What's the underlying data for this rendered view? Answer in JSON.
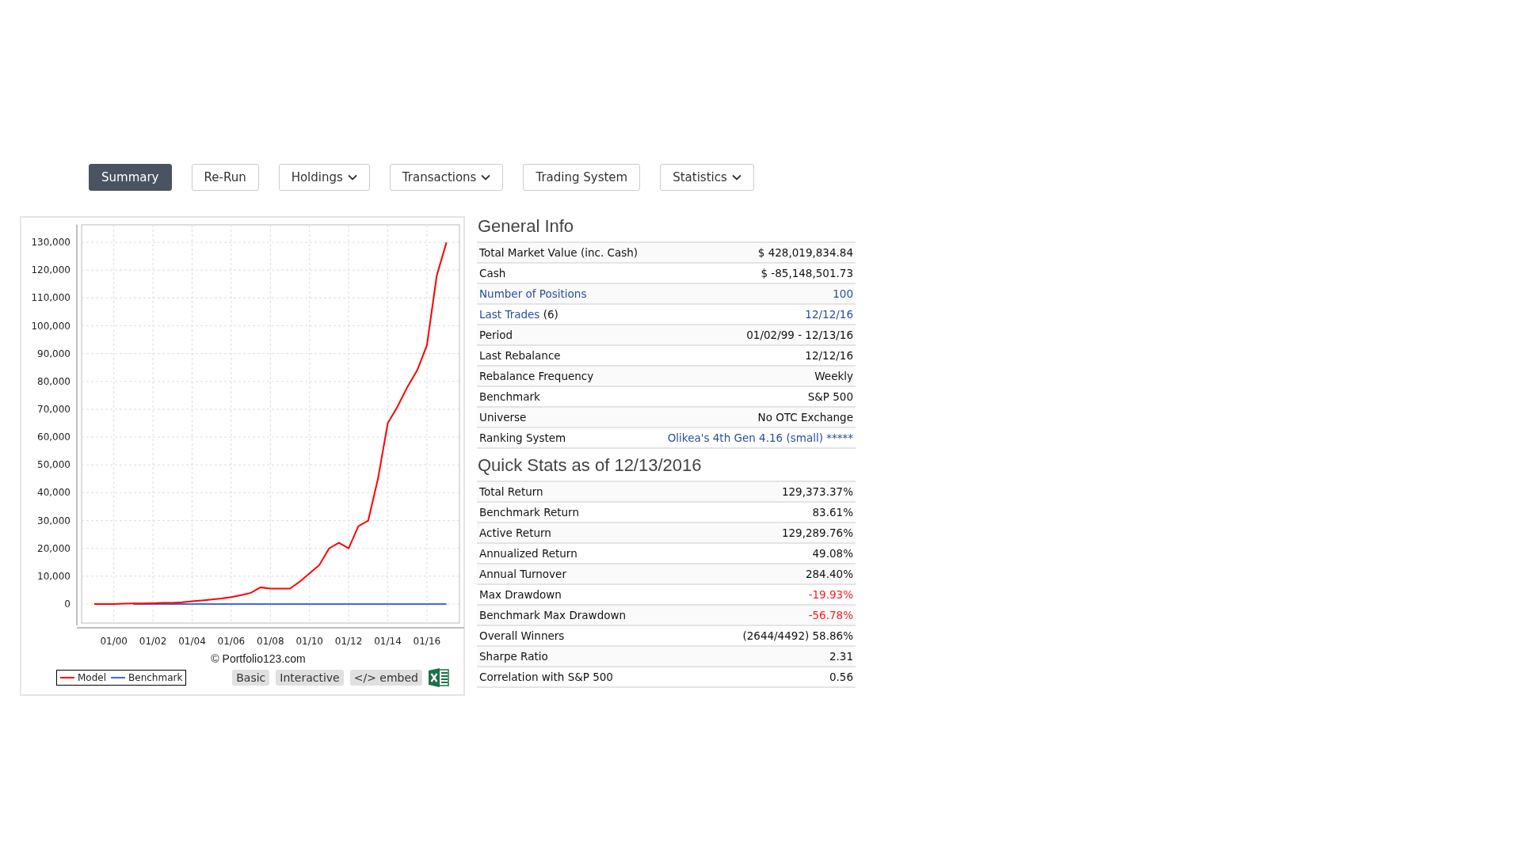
{
  "tabs": [
    {
      "label": "Summary",
      "selected": true,
      "dropdown": false
    },
    {
      "label": "Re-Run",
      "selected": false,
      "dropdown": false
    },
    {
      "label": "Holdings",
      "selected": false,
      "dropdown": true
    },
    {
      "label": "Transactions",
      "selected": false,
      "dropdown": true
    },
    {
      "label": "Trading System",
      "selected": false,
      "dropdown": false
    },
    {
      "label": "Statistics",
      "selected": false,
      "dropdown": true
    }
  ],
  "chart_panel": {
    "chart_data": {
      "type": "line",
      "categories": [
        null,
        null,
        "01/00",
        null,
        null,
        null,
        "01/02",
        null,
        null,
        null,
        "01/04",
        null,
        null,
        null,
        "01/06",
        null,
        null,
        null,
        "01/08",
        null,
        null,
        null,
        "01/10",
        null,
        null,
        null,
        "01/12",
        null,
        null,
        null,
        "01/14",
        null,
        null,
        null,
        "01/16",
        null,
        null
      ],
      "series": [
        {
          "name": "Model",
          "color": "#ff0000",
          "values": [
            0,
            0,
            0,
            100,
            200,
            200,
            300,
            400,
            400,
            600,
            1000,
            1300,
            1600,
            2000,
            2500,
            3200,
            4000,
            6000,
            5500,
            5500,
            5500,
            8000,
            11000,
            14000,
            20000,
            22000,
            20000,
            28000,
            30000,
            45000,
            65000,
            71000,
            78000,
            84000,
            93000,
            118000,
            130000
          ]
        },
        {
          "name": "Benchmark",
          "color": "#4169e1",
          "values": [
            null,
            null,
            null,
            null,
            0,
            0,
            0,
            0,
            0,
            0,
            0,
            0,
            0,
            0,
            0,
            0,
            0,
            0,
            0,
            0,
            0,
            0,
            0,
            0,
            0,
            0,
            0,
            0,
            0,
            0,
            0,
            0,
            0,
            0,
            0,
            0,
            0
          ]
        }
      ],
      "ylim": [
        -7700,
        136300
      ],
      "grid": true,
      "yticks": [
        {
          "value": 0,
          "label": "0"
        },
        {
          "value": 10000,
          "label": "10,000"
        },
        {
          "value": 20000,
          "label": "20,000"
        },
        {
          "value": 30000,
          "label": "30,000"
        },
        {
          "value": 40000,
          "label": "40,000"
        },
        {
          "value": 50000,
          "label": "50,000"
        },
        {
          "value": 60000,
          "label": "60,000"
        },
        {
          "value": 70000,
          "label": "70,000"
        },
        {
          "value": 80000,
          "label": "80,000"
        },
        {
          "value": 90000,
          "label": "90,000"
        },
        {
          "value": 100000,
          "label": "100,000"
        },
        {
          "value": 110000,
          "label": "110,000"
        },
        {
          "value": 120000,
          "label": "120,000"
        },
        {
          "value": 130000,
          "label": "130,000"
        }
      ]
    },
    "copyright": "© Portfolio123.com",
    "buttons": [
      "Basic",
      "Interactive",
      "</> embed"
    ]
  },
  "sections": [
    {
      "title": "General Info",
      "rows": [
        {
          "label": "Total Market Value (inc. Cash)",
          "value": "$ 428,019,834.84",
          "label_link": false,
          "value_link": false,
          "negative": false
        },
        {
          "label": "Cash",
          "value": "$ -85,148,501.73",
          "label_link": false,
          "value_link": false,
          "negative": false
        },
        {
          "label": "Number of Positions",
          "value": "100",
          "label_link": true,
          "value_link": true,
          "negative": false
        },
        {
          "label": "Last Trades",
          "label_note": "(6)",
          "value": "12/12/16",
          "label_link": true,
          "value_link": true,
          "negative": false
        },
        {
          "label": "Period",
          "value": "01/02/99 - 12/13/16",
          "label_link": false,
          "value_link": false,
          "negative": false
        },
        {
          "label": "Last Rebalance",
          "value": "12/12/16",
          "label_link": false,
          "value_link": false,
          "negative": false
        },
        {
          "label": "Rebalance Frequency",
          "value": "Weekly",
          "label_link": false,
          "value_link": false,
          "negative": false
        },
        {
          "label": "Benchmark",
          "value": "S&P 500",
          "label_link": false,
          "value_link": false,
          "negative": false
        },
        {
          "label": "Universe",
          "value": "No OTC Exchange",
          "label_link": false,
          "value_link": false,
          "negative": false
        },
        {
          "label": "Ranking System",
          "value": "Olikea's 4th Gen 4.16 (small)",
          "value_note": "*****",
          "label_link": false,
          "value_link": true,
          "negative": false
        }
      ]
    },
    {
      "title": "Quick Stats as of 12/13/2016",
      "rows": [
        {
          "label": "Total Return",
          "value": "129,373.37%",
          "label_link": false,
          "value_link": false,
          "negative": false
        },
        {
          "label": "Benchmark Return",
          "value": "83.61%",
          "label_link": false,
          "value_link": false,
          "negative": false
        },
        {
          "label": "Active Return",
          "value": "129,289.76%",
          "label_link": false,
          "value_link": false,
          "negative": false
        },
        {
          "label": "Annualized Return",
          "value": "49.08%",
          "label_link": false,
          "value_link": false,
          "negative": false
        },
        {
          "label": "Annual Turnover",
          "value": "284.40%",
          "label_link": false,
          "value_link": false,
          "negative": false
        },
        {
          "label": "Max Drawdown",
          "value": "-19.93%",
          "label_link": false,
          "value_link": false,
          "negative": true
        },
        {
          "label": "Benchmark Max Drawdown",
          "value": "-56.78%",
          "label_link": false,
          "value_link": false,
          "negative": true
        },
        {
          "label": "Overall Winners",
          "value": "(2644/4492) 58.86%",
          "label_link": false,
          "value_link": false,
          "negative": false
        },
        {
          "label": "Sharpe Ratio",
          "value": "2.31",
          "label_link": false,
          "value_link": false,
          "negative": false
        },
        {
          "label": "Correlation with S&P 500",
          "value": "0.56",
          "label_link": false,
          "value_link": false,
          "negative": false
        }
      ]
    }
  ]
}
